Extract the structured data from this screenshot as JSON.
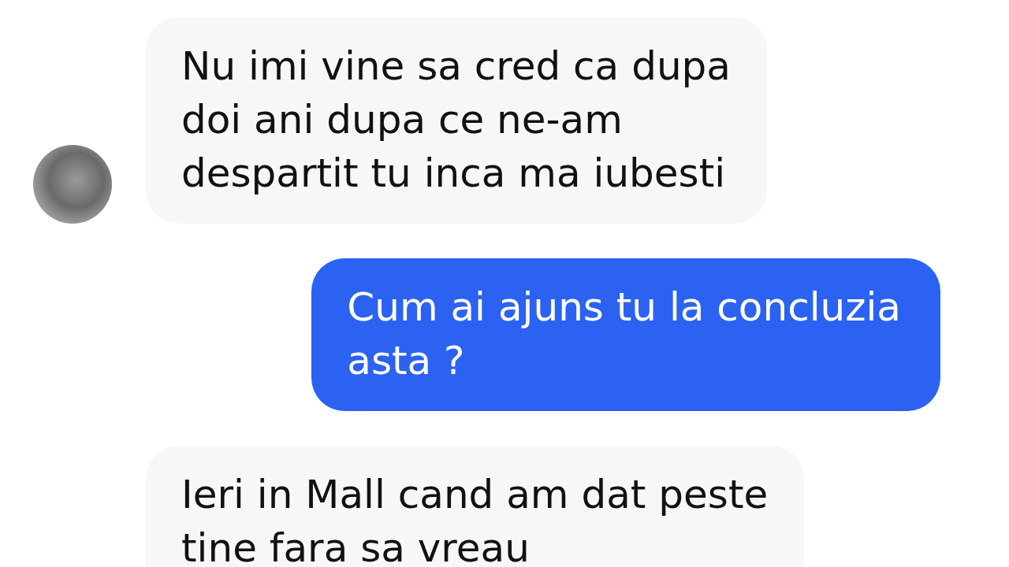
{
  "messages": [
    {
      "kind": "incoming",
      "avatar": true,
      "lines": [
        "Nu imi vine sa cred ca dupa",
        "doi ani dupa ce ne-am",
        "despartit tu inca ma iubesti"
      ]
    },
    {
      "kind": "outgoing",
      "lines": [
        "Cum ai ajuns tu la concluzia",
        "asta ?"
      ]
    },
    {
      "kind": "incoming",
      "lines": [
        "Ieri in Mall cand am dat peste",
        "tine fara sa vreau"
      ]
    }
  ]
}
